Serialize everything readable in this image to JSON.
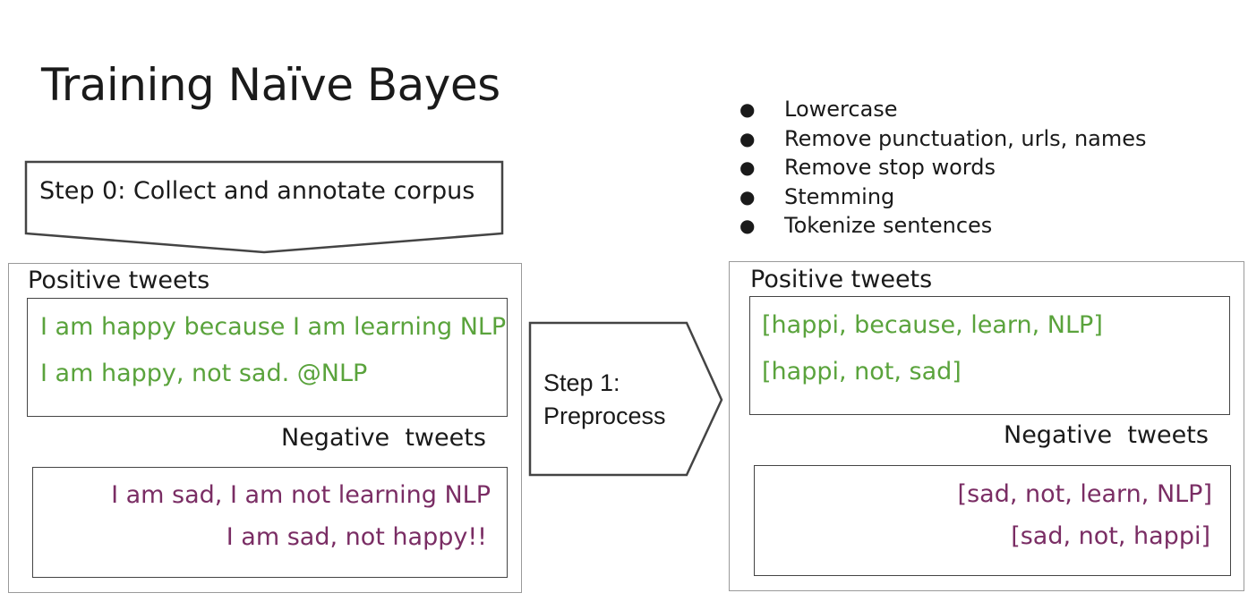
{
  "title": "Training Naïve Bayes",
  "step0": {
    "label": "Step 0: Collect and annotate corpus"
  },
  "step1": {
    "line1": "Step 1:",
    "line2": "Preprocess"
  },
  "preprocessing_steps": [
    "Lowercase",
    "Remove punctuation, urls, names",
    "Remove stop words",
    "Stemming",
    "Tokenize sentences"
  ],
  "raw_corpus": {
    "positive_label": "Positive tweets",
    "positive": [
      "I am happy because I am learning NLP",
      "I am happy, not sad. @NLP"
    ],
    "negative_label": "Negative  tweets",
    "negative": [
      "I am sad, I am not learning NLP",
      "I am sad, not happy!!"
    ]
  },
  "processed_corpus": {
    "positive_label": "Positive tweets",
    "positive": [
      "[happi, because, learn, NLP]",
      "[happi, not, sad]"
    ],
    "negative_label": "Negative  tweets",
    "negative": [
      "[sad, not, learn, NLP]",
      "[sad, not, happi]"
    ]
  },
  "colors": {
    "positive": "#5aa33c",
    "negative": "#7a2d64",
    "outline": "#9a9a9a"
  }
}
